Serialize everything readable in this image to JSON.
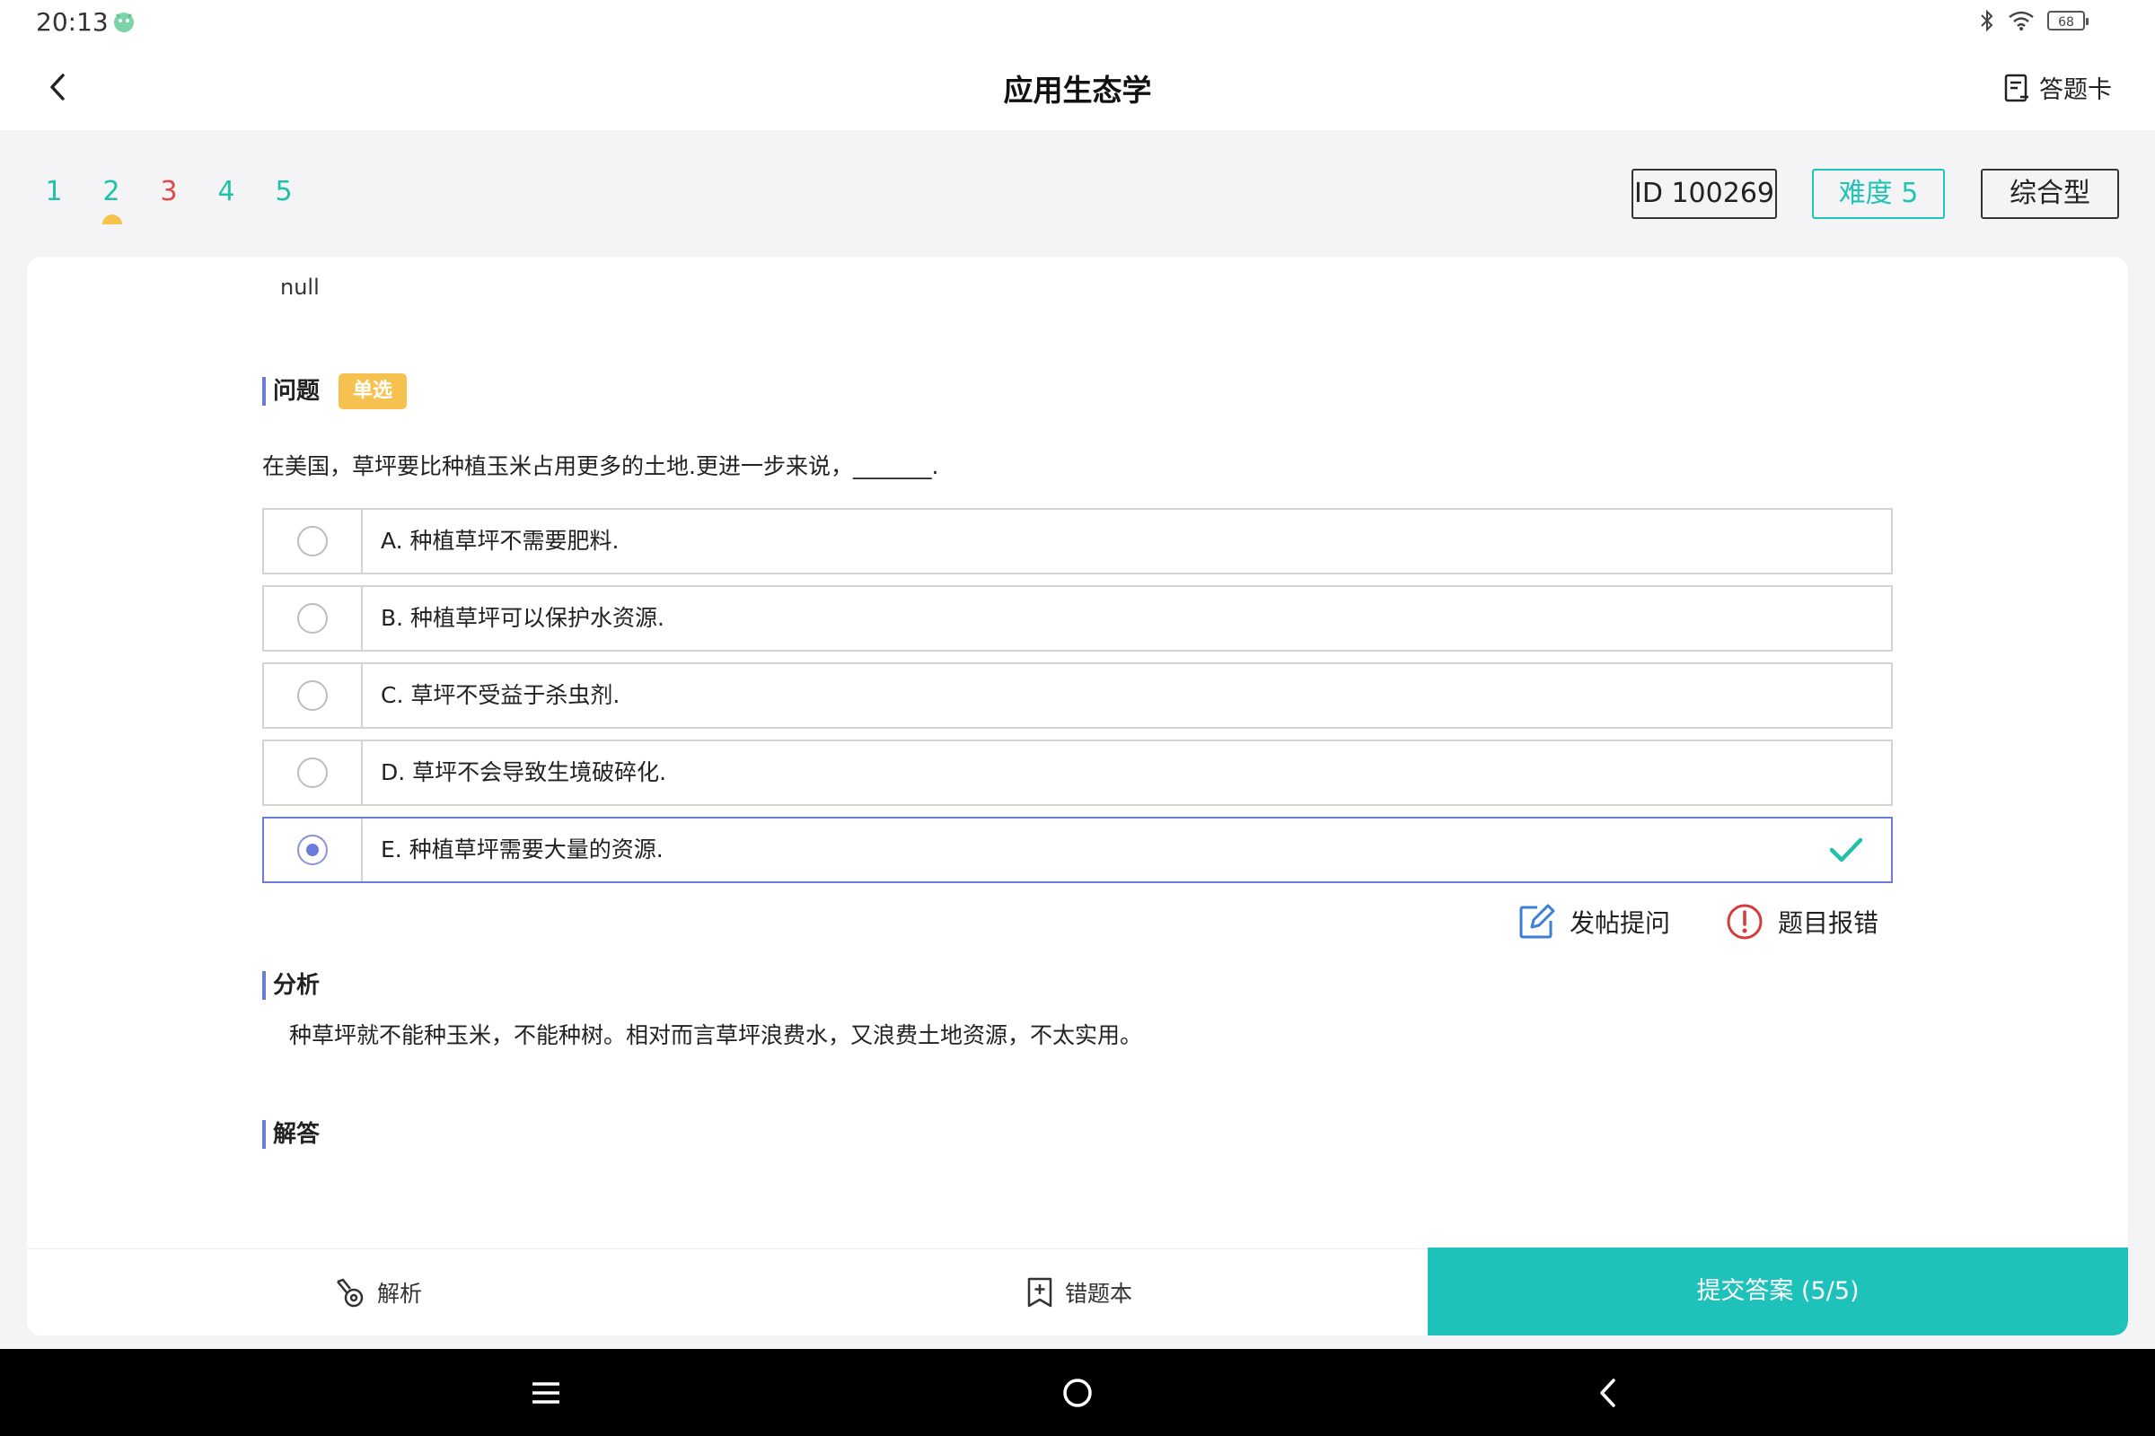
{
  "status": {
    "time": "20:13",
    "battery": "68"
  },
  "header": {
    "title": "应用生态学",
    "answer_card": "答题卡"
  },
  "question_nav": [
    {
      "label": "1",
      "color": "#1fc1a8",
      "current": false
    },
    {
      "label": "2",
      "color": "#1fc1a8",
      "current": true
    },
    {
      "label": "3",
      "color": "#e34848",
      "current": false
    },
    {
      "label": "4",
      "color": "#1fc1a8",
      "current": false
    },
    {
      "label": "5",
      "color": "#1fc1a8",
      "current": false
    }
  ],
  "tags": {
    "id": "ID 100269",
    "difficulty": "难度 5",
    "type": "综合型"
  },
  "content": {
    "null_text": "null",
    "question_heading": "问题",
    "question_type": "单选",
    "stem": "在美国，草坪要比种植玉米占用更多的土地.更进一步来说，_______.",
    "options": [
      {
        "label": "A. 种植草坪不需要肥料.",
        "selected": false,
        "correct": false
      },
      {
        "label": "B. 种植草坪可以保护水资源.",
        "selected": false,
        "correct": false
      },
      {
        "label": "C. 草坪不受益于杀虫剂.",
        "selected": false,
        "correct": false
      },
      {
        "label": "D. 草坪不会导致生境破碎化.",
        "selected": false,
        "correct": false
      },
      {
        "label": "E. 种植草坪需要大量的资源.",
        "selected": true,
        "correct": true
      }
    ],
    "post_question": "发帖提问",
    "report_error": "题目报错",
    "analysis_heading": "分析",
    "analysis_text": "种草坪就不能种玉米，不能种树。相对而言草坪浪费水，又浪费土地资源，不太实用。",
    "answer_heading": "解答"
  },
  "bottom": {
    "explain": "解析",
    "wrong_book": "错题本",
    "submit": "提交答案 (5/5)"
  },
  "colors": {
    "accent": "#1fc1bb",
    "selected": "#6a7bd8",
    "badge": "#f7c14f",
    "error": "#e34848"
  }
}
